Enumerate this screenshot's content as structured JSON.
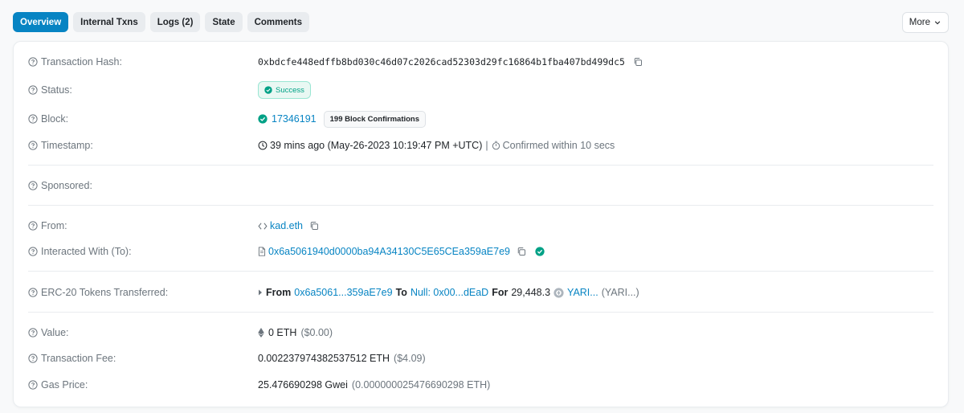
{
  "tabs": [
    {
      "label": "Overview",
      "active": true
    },
    {
      "label": "Internal Txns",
      "active": false
    },
    {
      "label": "Logs (2)",
      "active": false
    },
    {
      "label": "State",
      "active": false
    },
    {
      "label": "Comments",
      "active": false
    }
  ],
  "more_label": "More",
  "colors": {
    "accent": "#0784c3",
    "success": "#00a186"
  },
  "rows": {
    "tx_hash": {
      "label": "Transaction Hash:",
      "value": "0xbdcfe448edffb8bd030c46d07c2026cad52303d29fc16864b1fba407bd499dc5"
    },
    "status": {
      "label": "Status:",
      "value": "Success"
    },
    "block": {
      "label": "Block:",
      "value": "17346191",
      "confirmations": "199 Block Confirmations"
    },
    "timestamp": {
      "label": "Timestamp:",
      "value": "39 mins ago (May-26-2023 10:19:47 PM +UTC)",
      "separator": "|",
      "confirmed": "Confirmed within 10 secs"
    },
    "sponsored": {
      "label": "Sponsored:"
    },
    "from": {
      "label": "From:",
      "value": "kad.eth"
    },
    "to": {
      "label": "Interacted With (To):",
      "value": "0x6a5061940d0000ba94A34130C5E65CEa359aE7e9"
    },
    "erc20": {
      "label": "ERC-20 Tokens Transferred:",
      "from_word": "From",
      "from_addr": "0x6a5061...359aE7e9",
      "to_word": "To",
      "to_addr": "Null: 0x00...dEaD",
      "for_word": "For",
      "amount": "29,448.3",
      "token": "YARI...",
      "token_symbol": "(YARI...)"
    },
    "value": {
      "label": "Value:",
      "amount": "0 ETH",
      "usd": "($0.00)"
    },
    "fee": {
      "label": "Transaction Fee:",
      "amount": "0.002237974382537512 ETH",
      "usd": "($4.09)"
    },
    "gas": {
      "label": "Gas Price:",
      "amount": "25.476690298 Gwei",
      "eth": "(0.000000025476690298 ETH)"
    }
  }
}
